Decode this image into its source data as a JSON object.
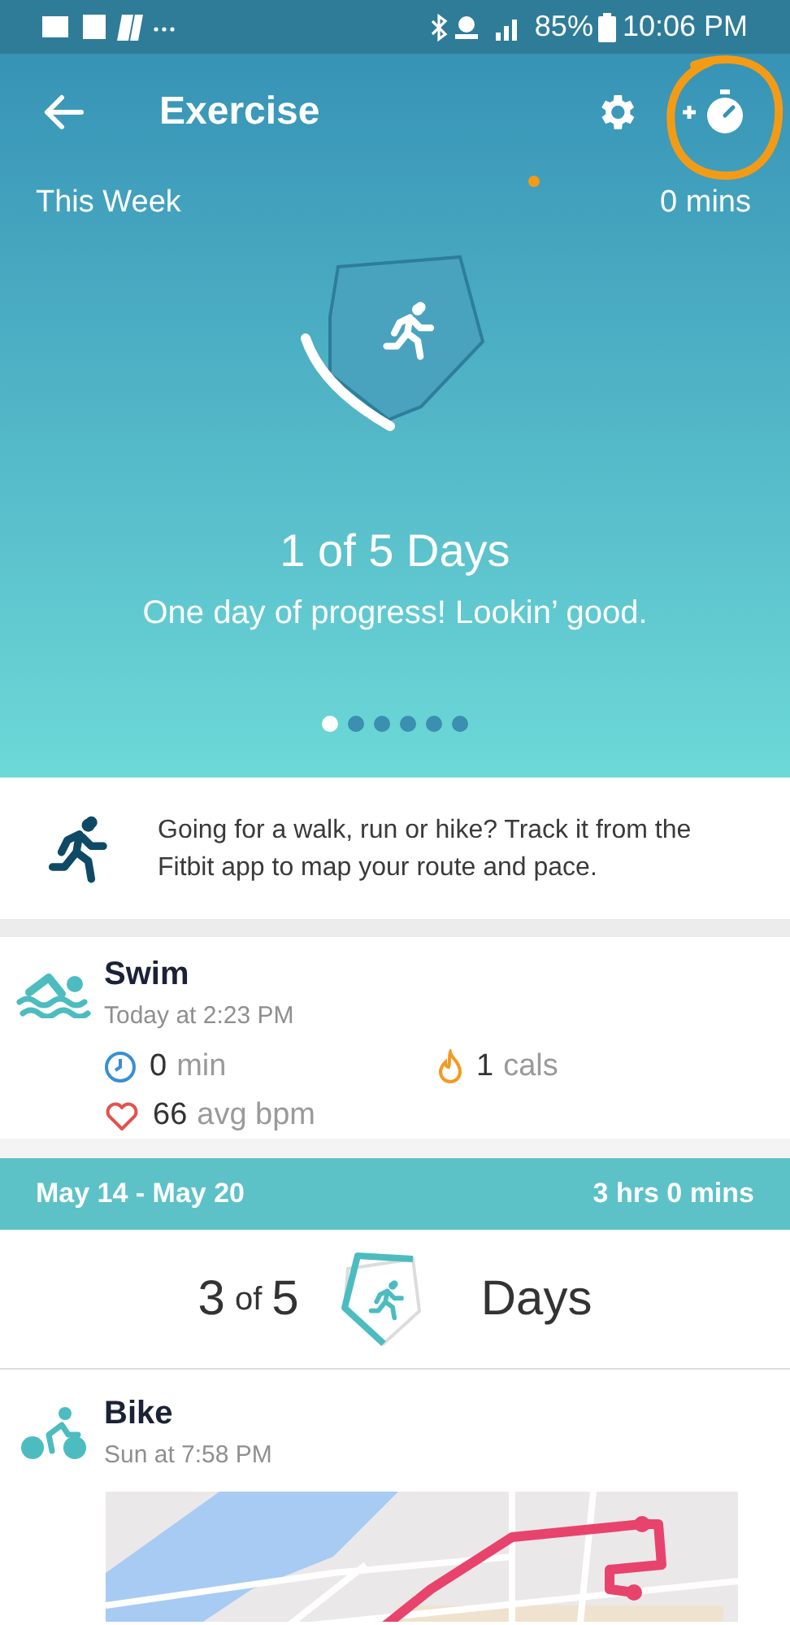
{
  "status_bar": {
    "battery": "85%",
    "time": "10:06 PM"
  },
  "header": {
    "title": "Exercise"
  },
  "week": {
    "label": "This Week",
    "total": "0 mins",
    "days": "1 of 5 Days",
    "message": "One day of progress! Lookin’ good."
  },
  "pager": [
    {
      "selected": true
    },
    {
      "selected": false
    },
    {
      "selected": false
    },
    {
      "selected": false
    },
    {
      "selected": false
    },
    {
      "selected": false
    }
  ],
  "tip": {
    "text": "Going for a walk, run or hike? Track it from the Fitbit app to map your route and pace."
  },
  "recent": {
    "kind": "swim",
    "name": "Swim",
    "time": "Today at 2:23 PM",
    "stats": [
      {
        "kind": "duration",
        "value": "0",
        "unit": "min"
      },
      {
        "kind": "calories",
        "value": "1",
        "unit": "cals"
      },
      {
        "kind": "heart",
        "value": "66",
        "unit": "avg bpm"
      }
    ]
  },
  "summary": {
    "range": "May 14 - May 20",
    "total": "3 hrs 0 mins",
    "count": "3",
    "of": "of",
    "goal": "5",
    "unit": "Days"
  },
  "activity": {
    "kind": "bike",
    "name": "Bike",
    "time": "Sun at 7:58 PM"
  }
}
